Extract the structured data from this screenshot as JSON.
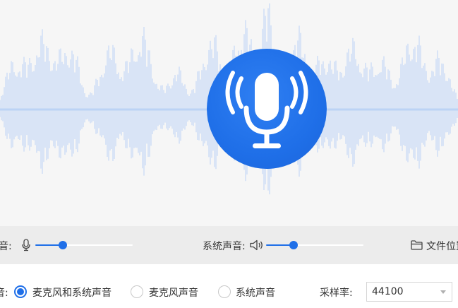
{
  "controls": {
    "mic_volume_label": "音:",
    "mic_volume": 0.28,
    "system_volume_label": "系统声音:",
    "system_volume": 0.28,
    "file_location_label": "文件位置"
  },
  "options": {
    "source_label": "音:",
    "sources": [
      {
        "label": "麦克风和系统声音",
        "selected": true
      },
      {
        "label": "麦克风声音",
        "selected": false
      },
      {
        "label": "系统声音",
        "selected": false
      }
    ],
    "sample_rate_label": "采样率:",
    "sample_rate_value": "44100"
  },
  "colors": {
    "accent": "#1f6fe8",
    "waveform": "#bcd3f5",
    "hero_background": "#f6f6f6",
    "controls_background": "#ececec"
  },
  "icons": {
    "hero": "microphone-broadcast-icon",
    "mic": "microphone-icon",
    "speaker": "speaker-icon",
    "folder": "folder-icon"
  }
}
